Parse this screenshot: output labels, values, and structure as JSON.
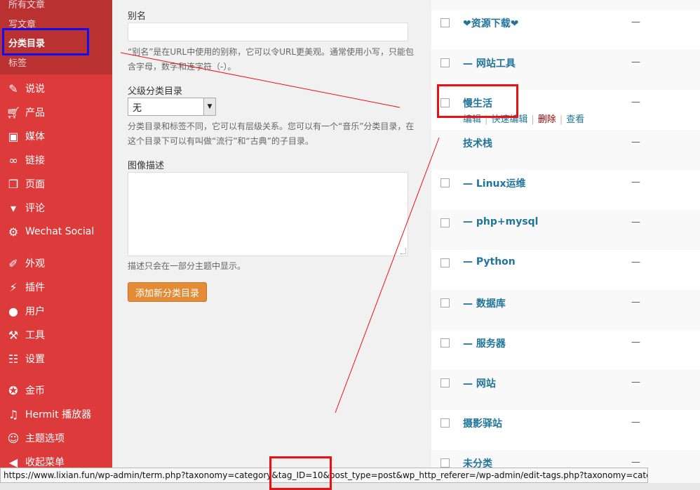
{
  "sidebar": {
    "submenu": [
      {
        "label": "所有文章"
      },
      {
        "label": "写文章"
      },
      {
        "label": "分类目录"
      },
      {
        "label": "标签"
      }
    ],
    "items": [
      {
        "label": "说说",
        "icon": "pin-icon"
      },
      {
        "label": "产品",
        "icon": "cart-icon"
      },
      {
        "label": "媒体",
        "icon": "media-icon"
      },
      {
        "label": "链接",
        "icon": "link-icon"
      },
      {
        "label": "页面",
        "icon": "page-icon"
      },
      {
        "label": "评论",
        "icon": "comment-icon"
      },
      {
        "label": "Wechat Social",
        "icon": "gear-icon"
      },
      {
        "label": "外观",
        "icon": "brush-icon"
      },
      {
        "label": "插件",
        "icon": "plugin-icon"
      },
      {
        "label": "用户",
        "icon": "user-icon"
      },
      {
        "label": "工具",
        "icon": "wrench-icon"
      },
      {
        "label": "设置",
        "icon": "settings-icon"
      },
      {
        "label": "金币",
        "icon": "coin-icon"
      },
      {
        "label": "Hermit 播放器",
        "icon": "music-icon"
      },
      {
        "label": "主题选项",
        "icon": "theme-icon"
      },
      {
        "label": "收起菜单",
        "icon": "collapse-icon"
      }
    ]
  },
  "form": {
    "slug_label": "别名",
    "slug_value": "",
    "slug_help": "“别名”是在URL中使用的别称，它可以令URL更美观。通常使用小写，只能包含字母，数字和连字符（-）。",
    "parent_label": "父级分类目录",
    "parent_value": "无",
    "parent_help": "分类目录和标签不同，它可以有层级关系。您可以有一个“音乐”分类目录，在这个目录下可以有叫做“流行”和“古典”的子目录。",
    "desc_label": "图像描述",
    "desc_value": "",
    "desc_help": "描述只会在一部分主题中显示。",
    "submit_label": "添加新分类目录"
  },
  "table": {
    "rows": [
      {
        "name": "❤资源下载❤",
        "count": "—"
      },
      {
        "name": "— 网站工具",
        "count": "—"
      },
      {
        "name": "慢生活",
        "count": "—",
        "actions": [
          "编辑",
          "快速编辑",
          "删除",
          "查看"
        ]
      },
      {
        "name": "技术栈",
        "count": "—"
      },
      {
        "name": "— Linux运维",
        "count": "—"
      },
      {
        "name": "— php+mysql",
        "count": "—"
      },
      {
        "name": "— Python",
        "count": "—"
      },
      {
        "name": "— 数据库",
        "count": "—"
      },
      {
        "name": "— 服务器",
        "count": "—"
      },
      {
        "name": "— 网站",
        "count": "—"
      },
      {
        "name": "摄影驿站",
        "count": "—"
      },
      {
        "name": "未分类",
        "count": "—"
      }
    ]
  },
  "statusbar": {
    "url": "https://www.lixian.fun/wp-admin/term.php?taxonomy=category&tag_ID=10&post_type=post&wp_http_referer=/wp-admin/edit-tags.php?taxonomy=category"
  },
  "colors": {
    "sidebar_bg": "#dd3b3b",
    "submenu_bg": "#b93131",
    "link": "#21759b",
    "button": "#e38c37",
    "annotation_red": "#ee1010",
    "annotation_blue": "#1010ee"
  }
}
